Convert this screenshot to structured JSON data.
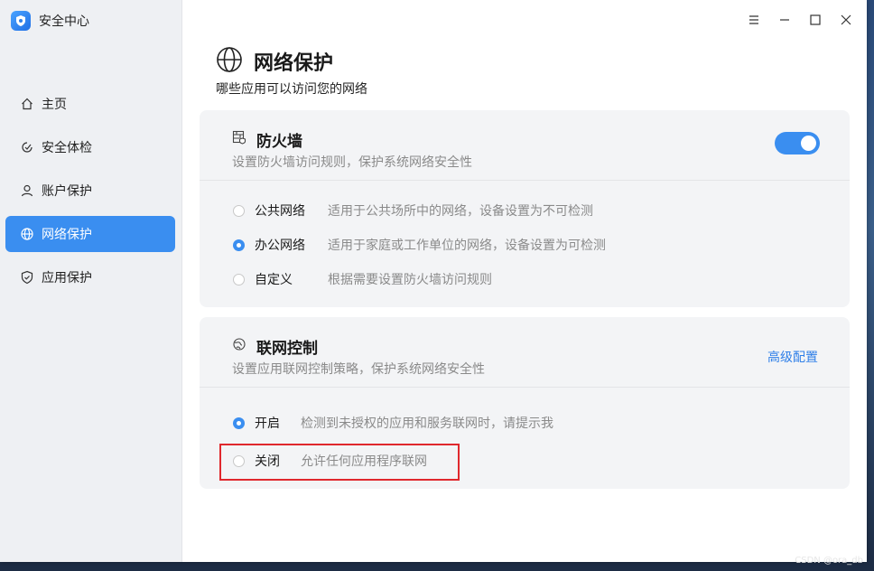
{
  "app": {
    "title": "安全中心",
    "accent": "#3a8ef0"
  },
  "sidebar": {
    "items": [
      {
        "label": "主页",
        "icon": "home-icon",
        "active": false
      },
      {
        "label": "安全体检",
        "icon": "scan-icon",
        "active": false
      },
      {
        "label": "账户保护",
        "icon": "user-icon",
        "active": false
      },
      {
        "label": "网络保护",
        "icon": "globe-icon",
        "active": true
      },
      {
        "label": "应用保护",
        "icon": "shield-icon",
        "active": false
      }
    ]
  },
  "window_controls": [
    "menu-icon",
    "minimize-icon",
    "maximize-icon",
    "close-icon"
  ],
  "page": {
    "title": "网络保护",
    "subtitle": "哪些应用可以访问您的网络",
    "icon": "globe-icon"
  },
  "firewall": {
    "title": "防火墙",
    "description": "设置防火墙访问规则，保护系统网络安全性",
    "enabled": true,
    "options": [
      {
        "label": "公共网络",
        "desc": "适用于公共场所中的网络，设备设置为不可检测",
        "selected": false
      },
      {
        "label": "办公网络",
        "desc": "适用于家庭或工作单位的网络，设备设置为可检测",
        "selected": true
      },
      {
        "label": "自定义",
        "desc": "根据需要设置防火墙访问规则",
        "selected": false
      }
    ]
  },
  "network_control": {
    "title": "联网控制",
    "description": "设置应用联网控制策略，保护系统网络安全性",
    "advanced_label": "高级配置",
    "options": [
      {
        "label": "开启",
        "desc": "检测到未授权的应用和服务联网时，请提示我",
        "selected": true
      },
      {
        "label": "关闭",
        "desc": "允许任何应用程序联网",
        "selected": false
      }
    ]
  },
  "watermark": "CSDN @ora_db"
}
